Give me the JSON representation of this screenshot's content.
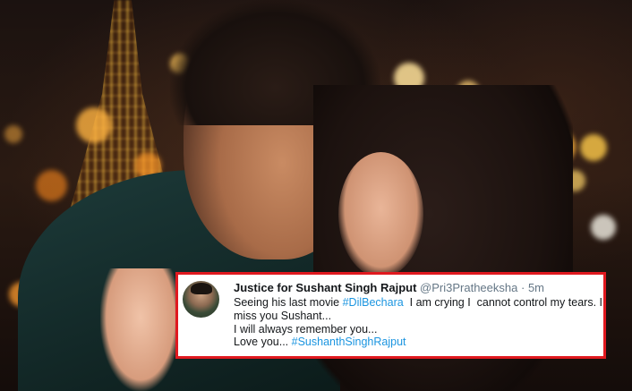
{
  "tweet": {
    "display_name": "Justice for Sushant Singh Rajput",
    "handle": "@Pri3Pratheeksha",
    "separator": "·",
    "time": "5m",
    "line1_prefix": "Seeing his last movie ",
    "hashtag1": "#DilBechara",
    "line1_suffix": "  I am crying I  cannot control my tears. I",
    "line2": "miss you Sushant...",
    "line3": "I will always remember you...",
    "line4_prefix": "Love you... ",
    "hashtag2": "#SushanthSinghRajput"
  },
  "colors": {
    "frame_border": "#e0191f",
    "hashtag": "#1b95e0",
    "muted_text": "#657786"
  },
  "icons": {
    "avatar": "profile-photo"
  }
}
